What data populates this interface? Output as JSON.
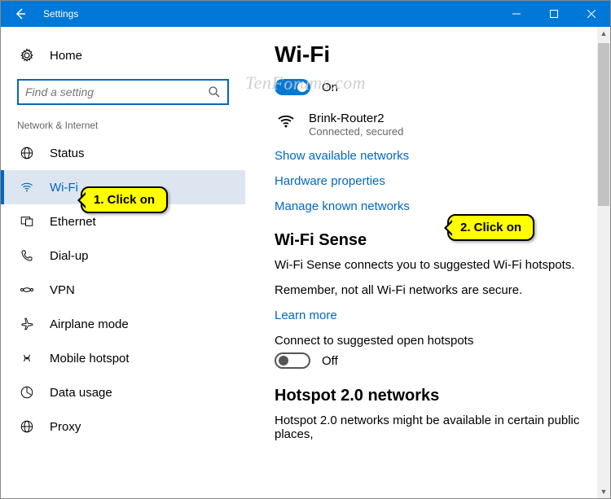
{
  "titlebar": {
    "title": "Settings"
  },
  "sidebar": {
    "home": "Home",
    "search_placeholder": "Find a setting",
    "category": "Network & Internet",
    "items": [
      {
        "label": "Status"
      },
      {
        "label": "Wi-Fi"
      },
      {
        "label": "Ethernet"
      },
      {
        "label": "Dial-up"
      },
      {
        "label": "VPN"
      },
      {
        "label": "Airplane mode"
      },
      {
        "label": "Mobile hotspot"
      },
      {
        "label": "Data usage"
      },
      {
        "label": "Proxy"
      }
    ]
  },
  "main": {
    "wifi_heading": "Wi-Fi",
    "wifi_on_label": "On",
    "network_name": "Brink-Router2",
    "network_status": "Connected, secured",
    "link_show": "Show available networks",
    "link_hw": "Hardware properties",
    "link_manage": "Manage known networks",
    "sense_heading": "Wi-Fi Sense",
    "sense_body": "Wi-Fi Sense connects you to suggested Wi-Fi hotspots.",
    "sense_note": "Remember, not all Wi-Fi networks are secure.",
    "learn_more": "Learn more",
    "connect_label": "Connect to suggested open hotspots",
    "connect_state": "Off",
    "hotspot20_heading": "Hotspot 2.0 networks",
    "hotspot20_body": "Hotspot 2.0 networks might be available in certain public places,"
  },
  "annotations": {
    "callout1": "1. Click on",
    "callout2": "2. Click on"
  },
  "watermark": "TenForums.com"
}
